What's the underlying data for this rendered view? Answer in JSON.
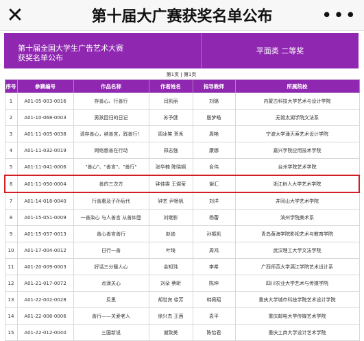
{
  "header": {
    "close_icon": "close-icon",
    "title": "第十届大广赛获奖名单公布",
    "more_icon": "more-icon"
  },
  "banner": {
    "line1": "第十届全国大学生广告艺术大赛",
    "line2": "获奖名单公布",
    "category": "平面类 二等奖"
  },
  "page_info": "第1页 | 第1页",
  "table": {
    "headers": [
      "序号",
      "参赛编号",
      "作品名称",
      "作者姓名",
      "指导教师",
      "所属院校"
    ],
    "rows": [
      [
        "1",
        "A01-05-003-0016",
        "存善心、行善行",
        "闫凯丽",
        "刘璐",
        "内蒙古科技大学艺术与设计学院"
      ],
      [
        "2",
        "A01-10-068-0003",
        "男孩回归的日记",
        "苏予健",
        "殷梦皓",
        "无锡太湖学院文法系"
      ],
      [
        "3",
        "A01-11-005-0038",
        "请存善心，纳善言，践善行！",
        "周冰笑  贺禾",
        "周艳",
        "宁波大学潘天寿艺术设计学院"
      ],
      [
        "4",
        "A01-11-032-0019",
        "网络慈善在行动",
        "郑志强",
        "康娜",
        "嘉兴学院应用技术学院"
      ],
      [
        "5",
        "A01-11-041-0006",
        "\"善心\"、\"善言\"、\"善行\"",
        "张华楠  陈晓娴",
        "俞伟",
        "台州学院艺术学院"
      ],
      [
        "6",
        "A01-11-050-0004",
        "善的三次方",
        "钟佳雯  王煜莹",
        "谢汇",
        "浙江树人大学艺术学院"
      ],
      [
        "7",
        "A01-14-018-0040",
        "行善惠及子孙后代",
        "钟艺  尹杨帆",
        "刘洋",
        "井冈山大学艺术学院"
      ],
      [
        "8",
        "A01-15-051-0009",
        "一善染心 与人善言 从善如登",
        "刘继影",
        "杨蕾",
        "滨州学院美术系"
      ],
      [
        "9",
        "A01-15-057-0013",
        "善心善言善行",
        "赵迪",
        "孙振凯",
        "青岛黄海学院影视艺术与教育学院"
      ],
      [
        "10",
        "A01-17-004-0012",
        "日行一善",
        "叶琦",
        "周鸿",
        "武汉理工大学文法学院"
      ],
      [
        "11",
        "A01-20-009-0003",
        "好话三分暖人心",
        "余知玮",
        "李希",
        "广西师范大学漓江学院艺术设计系"
      ],
      [
        "12",
        "A01-21-017-0072",
        "点滴关心",
        "刘朵  蔡昕",
        "陈坤",
        "四川农业大学艺术与传媒学院"
      ],
      [
        "13",
        "A01-22-002-0028",
        "反思",
        "胡世宾  徐芳",
        "韩佩昭",
        "重庆大学城市科技学院艺术设计学院"
      ],
      [
        "14",
        "A01-22-006-0006",
        "善行——关爱老人",
        "徐兴杰  王茜",
        "袁平",
        "重庆邮电大学传媒艺术学院"
      ],
      [
        "15",
        "A01-22-012-0040",
        "三国新说",
        "谢致美",
        "陈怡君",
        "重庆工商大学设计艺术学院"
      ]
    ]
  }
}
